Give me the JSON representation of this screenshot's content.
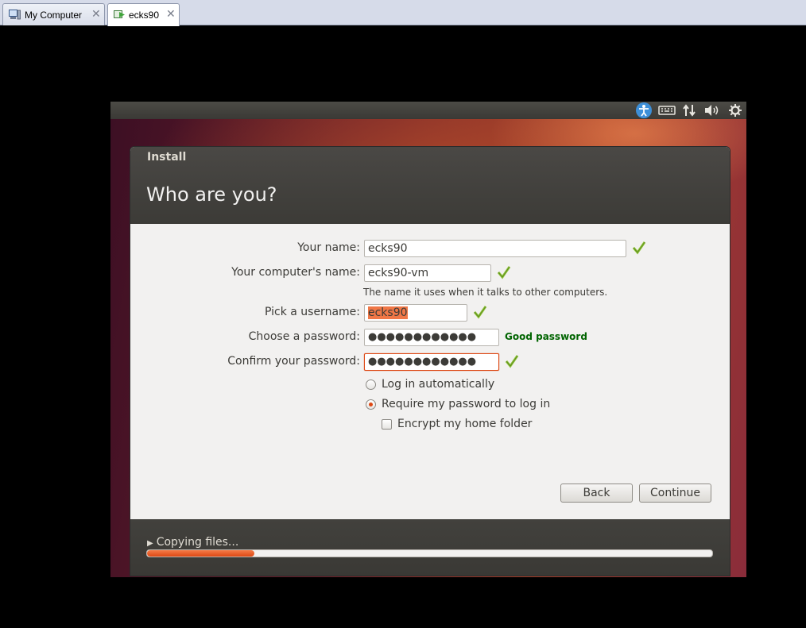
{
  "tabs": [
    {
      "label": "My Computer",
      "active": false
    },
    {
      "label": "ecks90",
      "active": true
    }
  ],
  "window": {
    "title": "Install",
    "heading": "Who are you?"
  },
  "form": {
    "name_label": "Your name:",
    "name_value": "ecks90",
    "computer_label": "Your computer's name:",
    "computer_value": "ecks90-vm",
    "computer_hint": "The name it uses when it talks to other computers.",
    "username_label": "Pick a username:",
    "username_value": "ecks90",
    "password_label": "Choose a password:",
    "password_value": "●●●●●●●●●●●●",
    "password_strength": "Good password",
    "confirm_label": "Confirm your password:",
    "confirm_value": "●●●●●●●●●●●●",
    "login_auto_label": "Log in automatically",
    "require_password_label": "Require my password to log in",
    "encrypt_label": "Encrypt my home folder",
    "selected_login_option": "require_password",
    "encrypt_checked": false
  },
  "buttons": {
    "back": "Back",
    "continue": "Continue"
  },
  "footer": {
    "progress_label": "Copying files...",
    "progress_fraction": 0.19
  },
  "colors": {
    "accent": "#dd4814",
    "check": "#8fc43a",
    "strength_good": "#006400"
  },
  "icons": {
    "tray": [
      "accessibility-icon",
      "keyboard-icon",
      "network-icon",
      "volume-icon",
      "settings-gear-icon"
    ]
  }
}
